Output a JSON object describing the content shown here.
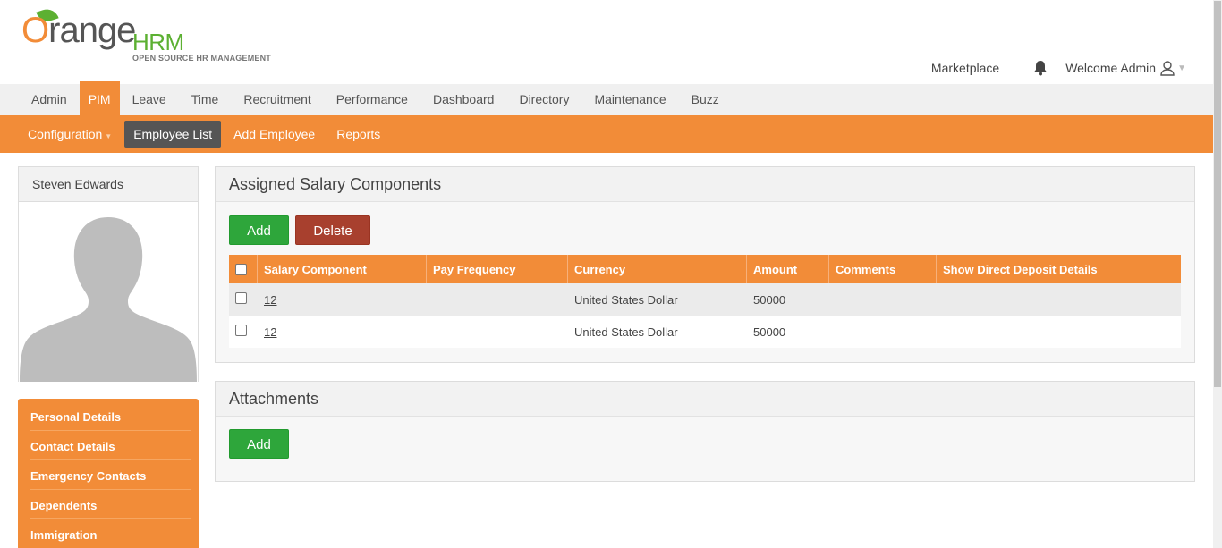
{
  "brand": {
    "logo_o": "O",
    "logo_range": "range",
    "logo_hrm": "HRM",
    "logo_tagline": "OPEN SOURCE HR MANAGEMENT"
  },
  "topbar": {
    "marketplace": "Marketplace",
    "welcome": "Welcome Admin"
  },
  "mainmenu": [
    "Admin",
    "PIM",
    "Leave",
    "Time",
    "Recruitment",
    "Performance",
    "Dashboard",
    "Directory",
    "Maintenance",
    "Buzz"
  ],
  "submenu": {
    "configuration": "Configuration",
    "employee_list": "Employee List",
    "add_employee": "Add Employee",
    "reports": "Reports"
  },
  "profile": {
    "name": "Steven Edwards"
  },
  "sidemenu": [
    "Personal Details",
    "Contact Details",
    "Emergency Contacts",
    "Dependents",
    "Immigration"
  ],
  "salary": {
    "title": "Assigned Salary Components",
    "add": "Add",
    "delete": "Delete",
    "columns": [
      "Salary Component",
      "Pay Frequency",
      "Currency",
      "Amount",
      "Comments",
      "Show Direct Deposit Details"
    ],
    "rows": [
      {
        "component": "12",
        "frequency": "",
        "currency": "United States Dollar",
        "amount": "50000",
        "comments": "",
        "deposit": ""
      },
      {
        "component": "12",
        "frequency": "",
        "currency": "United States Dollar",
        "amount": "50000",
        "comments": "",
        "deposit": ""
      }
    ]
  },
  "attachments": {
    "title": "Attachments",
    "add": "Add"
  },
  "colors": {
    "accent": "#f28c38",
    "add": "#2ea63b",
    "delete": "#a8402e"
  }
}
